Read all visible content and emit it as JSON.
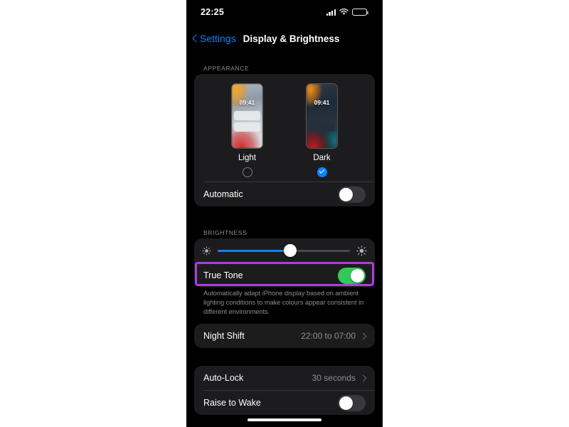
{
  "status_bar": {
    "time": "22:25",
    "signal_icon": "cellular-signal-icon",
    "wifi_icon": "wifi-icon",
    "battery_icon": "battery-icon"
  },
  "nav": {
    "back_label": "Settings",
    "title": "Display & Brightness"
  },
  "appearance": {
    "header": "APPEARANCE",
    "modes": [
      {
        "label": "Light",
        "preview_time": "09:41",
        "selected": false
      },
      {
        "label": "Dark",
        "preview_time": "09:41",
        "selected": true
      }
    ],
    "automatic": {
      "label": "Automatic",
      "on": false
    }
  },
  "brightness": {
    "header": "BRIGHTNESS",
    "slider": {
      "value_percent": 55,
      "low_icon": "brightness-low-icon",
      "high_icon": "brightness-high-icon"
    },
    "true_tone": {
      "label": "True Tone",
      "on": true,
      "description": "Automatically adapt iPhone display based on ambient lighting conditions to make colours appear consistent in different environments."
    },
    "night_shift": {
      "label": "Night Shift",
      "value": "22:00 to 07:00"
    }
  },
  "lock": {
    "auto_lock": {
      "label": "Auto-Lock",
      "value": "30 seconds"
    },
    "raise_to_wake": {
      "label": "Raise to Wake",
      "on": false
    }
  },
  "colors": {
    "accent_blue": "#0a84ff",
    "toggle_green": "#34c759",
    "highlight_purple": "#b03ce0",
    "card_bg": "#1c1c1e",
    "screen_bg": "#000000",
    "secondary_text": "#8e8e93"
  }
}
